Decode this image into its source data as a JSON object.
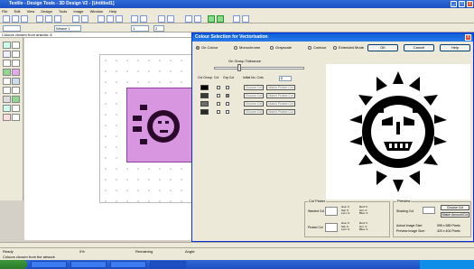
{
  "app": {
    "title": "Textile - Design Tools - 3D Design V2 - [Untitled1]",
    "menu": [
      "File",
      "Edit",
      "View",
      "Design",
      "Tools",
      "Image",
      "Window",
      "Help"
    ]
  },
  "toolbar": {
    "combo1": "Weave 1",
    "combo2": "1",
    "combo3": "2"
  },
  "canvas": {
    "status_text": "Colours chosen from artwork: 8"
  },
  "dialog": {
    "title": "Colour Selection for Vectorisation",
    "modes": [
      "On Colour",
      "Monochrome",
      "Grayscale",
      "Contour",
      "Extended Mode"
    ],
    "selected_mode": "On Colour",
    "buttons": {
      "ok": "OK",
      "cancel": "Cancel",
      "help": "Help"
    },
    "on_group_tolerance_label": "On Group Tolerance",
    "table_headers": {
      "col_group": "Col Group",
      "col": "Col",
      "grp": "Grp Col",
      "initial_no": "Initial No. Cols"
    },
    "initial_no_value": "8",
    "rows": [
      {
        "color": "#000000",
        "choose": "Choose Col",
        "match": "Match Picked Col"
      },
      {
        "color": "#3a3a3a",
        "choose": "Choose Col",
        "match": "Match Picked Col"
      },
      {
        "color": "#6e6e6e",
        "choose": "Choose Col",
        "match": "Match Picked Col"
      },
      {
        "color": "#2a2a2a",
        "choose": "Choose Col",
        "match": "Match Picked Col"
      }
    ],
    "colour_picker": {
      "title": "Col Picker",
      "wanted_col": "Wanted Col",
      "picked_col": "Picked Col",
      "hsv": "Hue: 0\nSat: 0\nLum: 0",
      "rgb": "Red: 0\nGrn: 0\nBlue: 0"
    },
    "preview": {
      "title": "Preview",
      "choose_col": "Choose Col",
      "shading_lbl": "Shading Col",
      "match_ultrasound": "Match Amount/Col",
      "actual_size_lbl": "Actual Image Size:",
      "actual_size_val": "595 x 585 Pixels",
      "preview_size_lbl": "Preview Image Size:",
      "preview_size_val": "420 x 404 Pixels"
    }
  },
  "statusbar": {
    "left": "Ready",
    "mid": "0%",
    "right1": "Remaining",
    "right2": "Angle:"
  },
  "status2": "Colours chosen from the artwork"
}
